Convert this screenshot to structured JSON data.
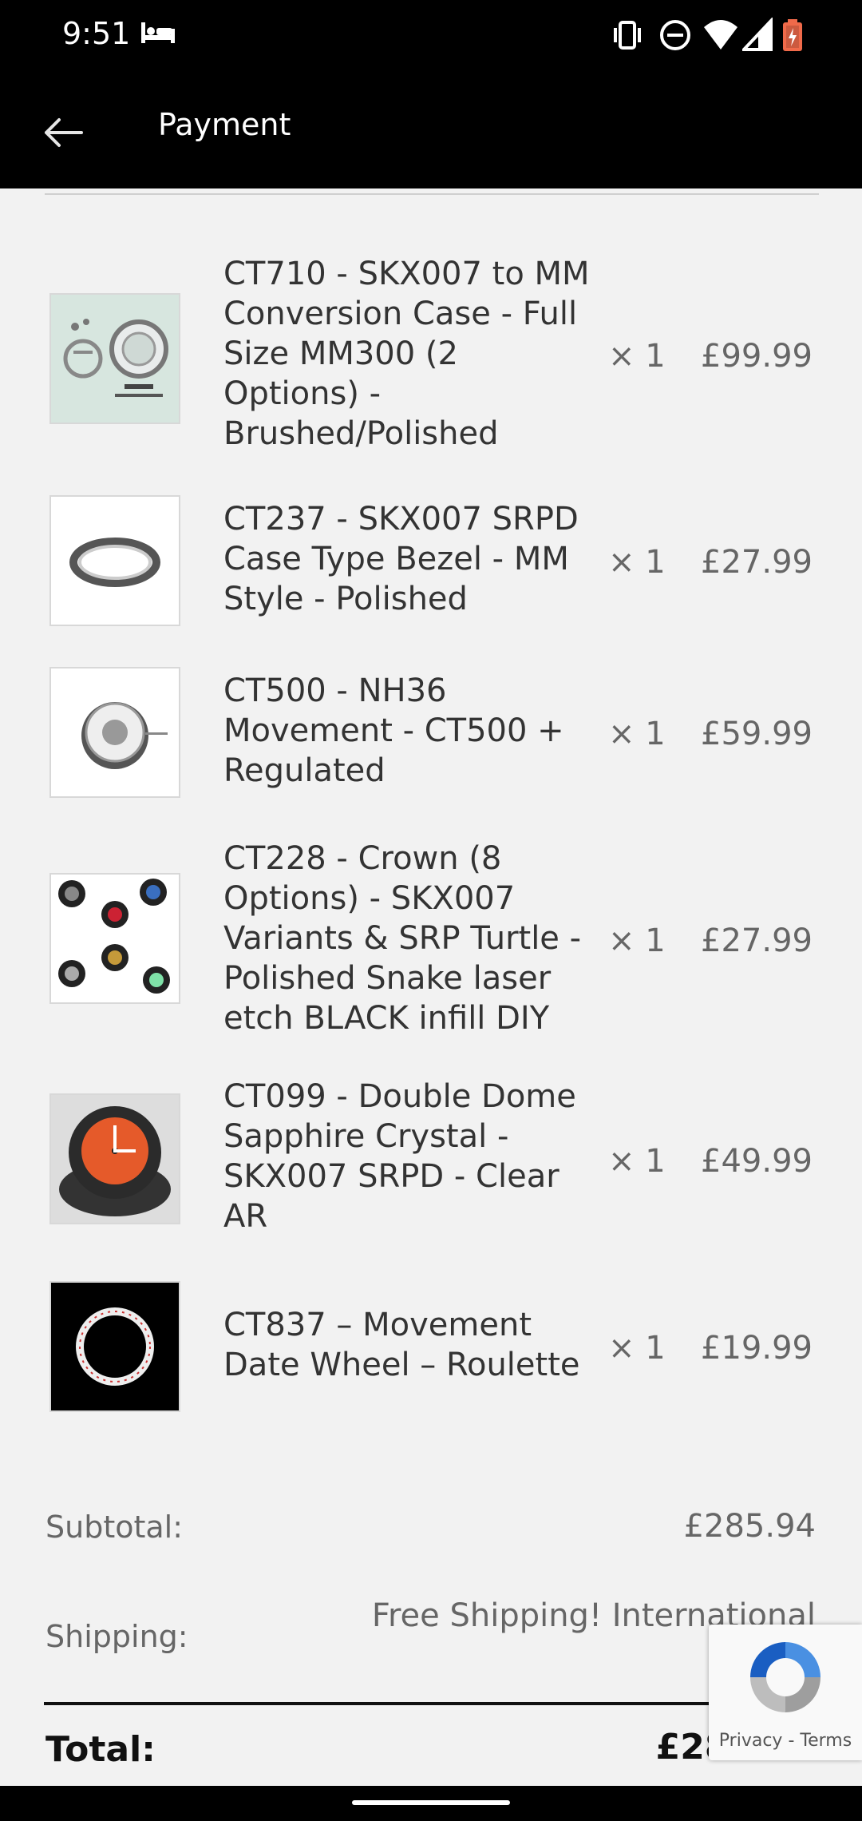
{
  "status_bar": {
    "time": "9:51"
  },
  "app_bar": {
    "title": "Payment"
  },
  "items": [
    {
      "name": "CT710 - SKX007 to MM Conversion Case - Full Size MM300 (2 Options) - Brushed/Polished",
      "qty": "× 1",
      "price": "£99.99",
      "thumb_icon": "conversion-case-icon"
    },
    {
      "name": "CT237 - SKX007 SRPD Case Type Bezel - MM Style - Polished",
      "qty": "× 1",
      "price": "£27.99",
      "thumb_icon": "bezel-icon"
    },
    {
      "name": "CT500 - NH36 Movement - CT500 + Regulated",
      "qty": "× 1",
      "price": "£59.99",
      "thumb_icon": "movement-icon"
    },
    {
      "name": "CT228 - Crown (8 Options) - SKX007 Variants & SRP Turtle - Polished Snake laser etch BLACK infill DIY",
      "qty": "× 1",
      "price": "£27.99",
      "thumb_icon": "crowns-icon"
    },
    {
      "name": "CT099 - Double Dome Sapphire Crystal - SKX007 SRPD - Clear AR",
      "qty": "× 1",
      "price": "£49.99",
      "thumb_icon": "watch-icon"
    },
    {
      "name": "CT837 – Movement Date Wheel – Roulette",
      "qty": "× 1",
      "price": "£19.99",
      "thumb_icon": "date-wheel-icon"
    }
  ],
  "summary": {
    "subtotal_label": "Subtotal:",
    "subtotal_value": "£285.94",
    "shipping_label": "Shipping:",
    "shipping_value": "Free Shipping! International",
    "total_label": "Total:",
    "total_value": "£285.94"
  },
  "recaptcha": {
    "privacy": "Privacy",
    "sep": " - ",
    "terms": "Terms"
  },
  "colors": {
    "bar_bg": "#000000",
    "page_bg": "#f2f2f2",
    "battery": "#f06a4a",
    "recaptcha_blue": "#4a90e2"
  }
}
